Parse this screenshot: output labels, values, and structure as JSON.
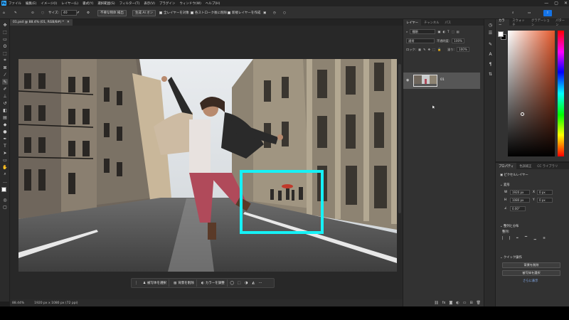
{
  "menu": {
    "items": [
      "ファイル",
      "編集(E)",
      "イメージ(I)",
      "レイヤー(L)",
      "書式(Y)",
      "選択範囲(S)",
      "フィルター(T)",
      "表示(V)",
      "プラグイン",
      "ウィンドウ(W)",
      "ヘルプ(H)"
    ]
  },
  "window_controls": [
    "—",
    "▢",
    "✕"
  ],
  "options": {
    "size_label": "サイズ:",
    "size_value": "40",
    "sample_all_layers": "不要な物体 検出",
    "ai_button": "生成 AI オン",
    "all_layers": "全レイヤーを対象",
    "stroke": "各ストローク後に削除",
    "new_layer": "新規レイヤーを作成"
  },
  "document": {
    "tab_title": "01.psd @ 88.4% (01, RGB/8#) *",
    "zoom": "88.44%",
    "dimensions": "1920 px x 1080 px (72 ppi)"
  },
  "taskbar": {
    "select_subject": "被写体を選択",
    "remove_bg": "背景を削除",
    "adjust_color": "カラーを調整"
  },
  "layers_panel": {
    "tabs": [
      "レイヤー",
      "チャンネル",
      "パス"
    ],
    "filter_kind": "種類",
    "blend_mode": "通常",
    "opacity_label": "不透明度:",
    "opacity_value": "100%",
    "lock_label": "ロック:",
    "fill_label": "塗り:",
    "fill_value": "100%",
    "layer_name": "01"
  },
  "color_panel": {
    "tabs": [
      "カラー",
      "スウォッチ",
      "グラデーション",
      "パターン"
    ],
    "foreground": "#ffffff",
    "background": "#000000"
  },
  "properties_panel": {
    "tabs": [
      "プロパティ",
      "色調補正",
      "CC ライブラリ"
    ],
    "layer_type": "ピクセルレイヤー",
    "transform_title": "変形",
    "w_label": "W",
    "w_value": "1920 px",
    "h_label": "H",
    "h_value": "1080 px",
    "x_label": "X",
    "x_value": "0 px",
    "y_label": "Y",
    "y_value": "0 px",
    "angle_value": "0.00°",
    "align_title": "整列と分布",
    "align_sub": "整列:",
    "quick_title": "クイック操作",
    "remove_bg_btn": "背景を削除",
    "select_subject_btn": "被写体を選択",
    "more": "さらに表示"
  },
  "colors": {
    "selection": "#16f1f6",
    "accent": "#31a8ff"
  }
}
